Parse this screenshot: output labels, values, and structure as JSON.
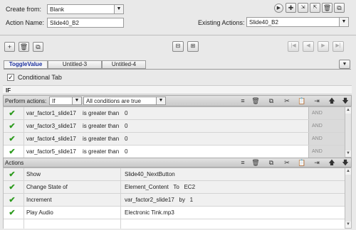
{
  "header": {
    "create_from_label": "Create from:",
    "create_from_value": "Blank",
    "action_name_label": "Action Name:",
    "action_name_value": "Slide40_B2",
    "existing_actions_label": "Existing Actions:",
    "existing_actions_value": "Slide40_B2"
  },
  "tabs": [
    {
      "label": "ToggleValue",
      "active": true
    },
    {
      "label": "Untitled-3",
      "active": false
    },
    {
      "label": "Untitled-4",
      "active": false
    }
  ],
  "conditional": {
    "label": "Conditional Tab",
    "checked": true
  },
  "if_label": "IF",
  "perform": {
    "label": "Perform actions:",
    "mode_value": "If",
    "condition_value": "All conditions are true"
  },
  "conditions": [
    {
      "variable": "var_factor1_slide17",
      "operator": "is greater than",
      "value": "0",
      "logic": "AND"
    },
    {
      "variable": "var_factor3_slide17",
      "operator": "is greater than",
      "value": "0",
      "logic": "AND"
    },
    {
      "variable": "var_factor4_slide17",
      "operator": "is greater than",
      "value": "0",
      "logic": "AND"
    },
    {
      "variable": "var_factor5_slide17",
      "operator": "is greater than",
      "value": "0",
      "logic": "AND"
    }
  ],
  "actions_label": "Actions",
  "actions": [
    {
      "action": "Show",
      "target": "Slide40_NextButton"
    },
    {
      "action": "Change State of",
      "target": "Element_Content   To   EC2"
    },
    {
      "action": "Increment",
      "target": "var_factor2_slide17   by   1"
    },
    {
      "action": "Play Audio",
      "target": "Electronic Tink.mp3"
    }
  ]
}
